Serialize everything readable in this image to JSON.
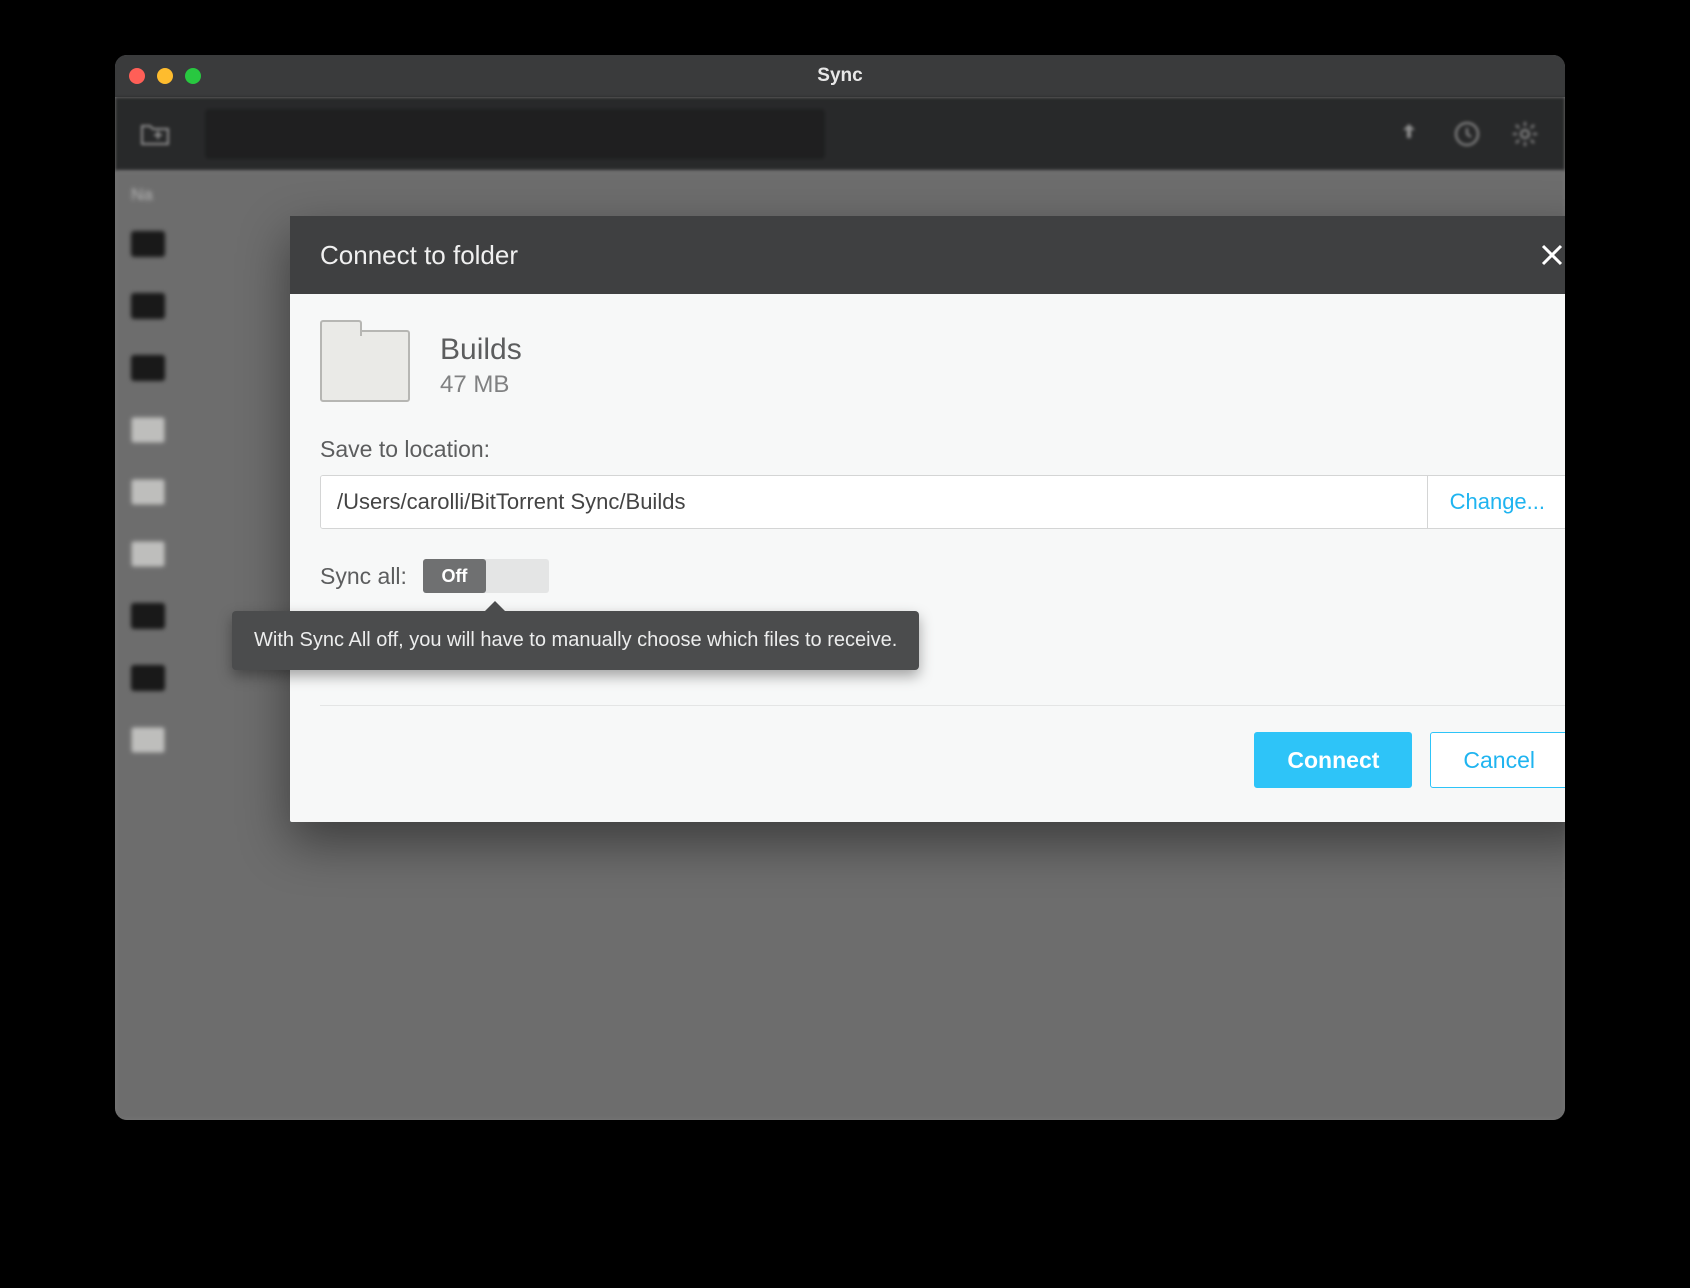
{
  "window": {
    "title": "Sync"
  },
  "toolbar": {},
  "list": {
    "header_name": "Na"
  },
  "modal": {
    "title": "Connect to folder",
    "folder": {
      "name": "Builds",
      "size": "47 MB"
    },
    "location": {
      "label": "Save to location:",
      "value": "/Users/carolli/BitTorrent Sync/Builds",
      "change_label": "Change..."
    },
    "sync_all": {
      "label": "Sync all:",
      "state_label": "Off",
      "tooltip": "With Sync All off, you will have to manually choose which files to receive."
    },
    "actions": {
      "connect": "Connect",
      "cancel": "Cancel"
    }
  }
}
